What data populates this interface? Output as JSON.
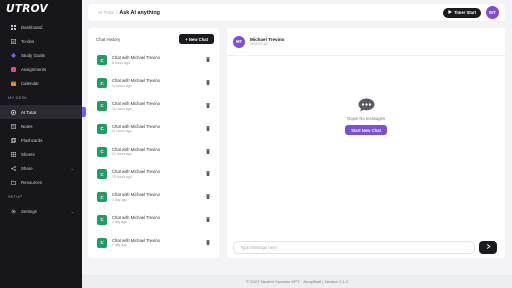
{
  "brand": {
    "logo_text": "UTROV"
  },
  "sidebar": {
    "main_items": [
      {
        "label": "Dashboard",
        "icon": "dashboard-icon"
      },
      {
        "label": "To-dos",
        "icon": "todo-icon"
      },
      {
        "label": "Study Goals",
        "icon": "goal-icon"
      },
      {
        "label": "Assignments",
        "icon": "assignment-icon"
      },
      {
        "label": "Calendar",
        "icon": "calendar-icon"
      }
    ],
    "desk_title": "MY DESK",
    "desk_items": [
      {
        "label": "AI Tutor",
        "icon": "ai-tutor-icon",
        "active": true
      },
      {
        "label": "Notes",
        "icon": "notes-icon"
      },
      {
        "label": "Flashcards",
        "icon": "flashcards-icon"
      },
      {
        "label": "Sheets",
        "icon": "sheets-icon"
      },
      {
        "label": "Share",
        "icon": "share-icon"
      },
      {
        "label": "Resources",
        "icon": "resources-icon"
      }
    ],
    "setup_title": "SETUP",
    "setup_items": [
      {
        "label": "Settings",
        "icon": "settings-icon"
      }
    ]
  },
  "topbar": {
    "breadcrumb_parent": "AI Tutor",
    "breadcrumb_sep": "/",
    "breadcrumb_current": "Ask AI anything",
    "timer_label": "Timer Start",
    "avatar_initials": "MT"
  },
  "history": {
    "title": "Chat History",
    "new_chat_label": "+ New Chat",
    "items": [
      {
        "badge": "C",
        "title": "Chat with Michael Trevino",
        "time": "8 hours ago"
      },
      {
        "badge": "C",
        "title": "Chat with Michael Trevino",
        "time": "11 hours ago"
      },
      {
        "badge": "C",
        "title": "Chat with Michael Trevino",
        "time": "11 hours ago"
      },
      {
        "badge": "C",
        "title": "Chat with Michael Trevino",
        "time": "11 hours ago"
      },
      {
        "badge": "C",
        "title": "Chat with Michael Trevino",
        "time": "12 hours ago"
      },
      {
        "badge": "C",
        "title": "Chat with Michael Trevino",
        "time": "19 hours ago"
      },
      {
        "badge": "C",
        "title": "Chat with Michael Trevino",
        "time": "1 day ago"
      },
      {
        "badge": "C",
        "title": "Chat with Michael Trevino",
        "time": "1 day ago"
      },
      {
        "badge": "C",
        "title": "Chat with Michael Trevino",
        "time": "1 day ago"
      }
    ]
  },
  "chat": {
    "avatar_initials": "MT",
    "name": "Michael Trevino",
    "date": "2024-07-16",
    "empty_text": "Oops! No messages",
    "start_label": "Start New Chat",
    "input_placeholder": "Type Message here"
  },
  "footer": {
    "text": "© 2023 Student Success GPT · JumpStart | Version 1.1.2"
  },
  "colors": {
    "accent": "#7a4fe0",
    "badge_green": "#1f9d63",
    "sidebar_bg": "#17171b",
    "dark_button": "#1a1a1f"
  }
}
